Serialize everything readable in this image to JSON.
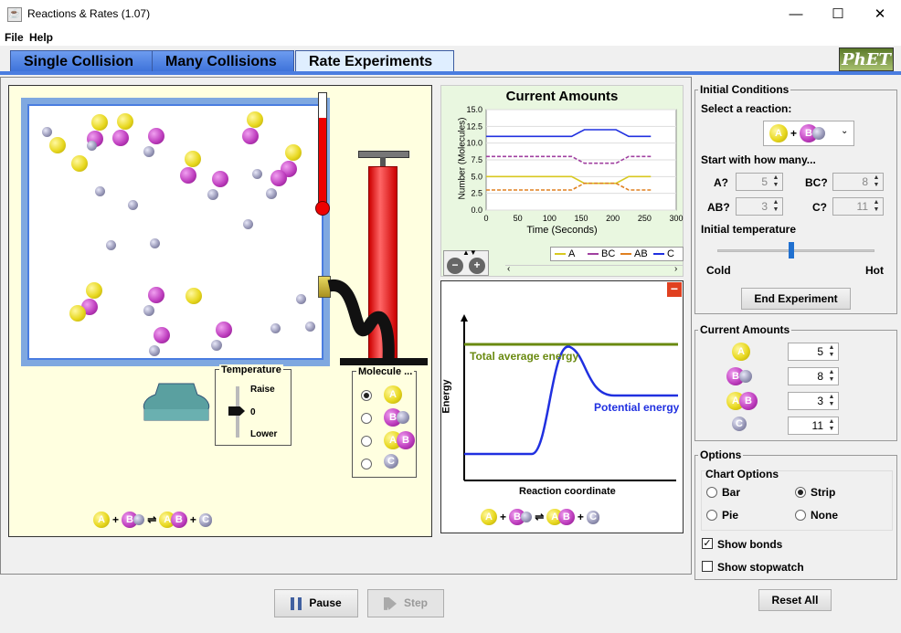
{
  "window": {
    "title": "Reactions & Rates (1.07)"
  },
  "menu": [
    "File",
    "Help"
  ],
  "tabs": [
    "Single Collision",
    "Many Collisions",
    "Rate Experiments"
  ],
  "logo": "PhET",
  "thermo_level": 0.78,
  "temperature_control": {
    "title": "Temperature",
    "raise": "Raise",
    "value": "0",
    "lower": "Lower"
  },
  "molecule_control": {
    "title": "Molecule ...",
    "options": [
      "A",
      "BC",
      "AB",
      "C"
    ],
    "selected": 0
  },
  "equation": {
    "a": "A",
    "plus": "+",
    "b": "B",
    "c": "C"
  },
  "chart": {
    "title": "Current Amounts",
    "ylabel": "Number (Molecules)",
    "xlabel": "Time (Seconds)",
    "legend": [
      "A",
      "BC",
      "AB",
      "C"
    ]
  },
  "chart_data": {
    "type": "line",
    "title": "Current Amounts",
    "xlabel": "Time (Seconds)",
    "ylabel": "Number (Molecules)",
    "xlim": [
      0,
      300
    ],
    "ylim": [
      0,
      15
    ],
    "xticks": [
      0,
      50,
      100,
      150,
      200,
      250,
      300
    ],
    "yticks": [
      "0.0",
      "2.5",
      "5.0",
      "7.5",
      "10.0",
      "12.5",
      "15.0"
    ],
    "x": [
      0,
      135,
      155,
      205,
      225,
      260
    ],
    "series": [
      {
        "name": "A",
        "color": "#d8c820",
        "values": [
          5,
          5,
          4,
          4,
          5,
          5
        ]
      },
      {
        "name": "BC",
        "color": "#a040a0",
        "values": [
          8,
          8,
          7,
          7,
          8,
          8
        ]
      },
      {
        "name": "AB",
        "color": "#e08020",
        "values": [
          3,
          3,
          4,
          4,
          3,
          3
        ]
      },
      {
        "name": "C",
        "color": "#2030e0",
        "values": [
          11,
          11,
          12,
          12,
          11,
          11
        ]
      }
    ]
  },
  "energy": {
    "total_label": "Total average energy",
    "potential_label": "Potential energy",
    "ylabel": "Energy",
    "xlabel": "Reaction coordinate",
    "colors": {
      "total": "#6a8a10",
      "potential": "#2030e0"
    }
  },
  "initial_conditions": {
    "title": "Initial Conditions",
    "select_label": "Select a reaction:",
    "start_label": "Start with how many...",
    "fields": [
      {
        "label": "A?",
        "value": "5"
      },
      {
        "label": "BC?",
        "value": "8"
      },
      {
        "label": "AB?",
        "value": "3"
      },
      {
        "label": "C?",
        "value": "11"
      }
    ],
    "initial_temp_label": "Initial temperature",
    "cold": "Cold",
    "hot": "Hot",
    "temp_level": 0.47,
    "end_button": "End Experiment"
  },
  "current_amounts": {
    "title": "Current Amounts",
    "values": [
      "5",
      "8",
      "3",
      "11"
    ]
  },
  "options": {
    "title": "Options",
    "chart_options_title": "Chart Options",
    "radios": [
      {
        "label": "Bar",
        "checked": false
      },
      {
        "label": "Strip",
        "checked": true
      },
      {
        "label": "Pie",
        "checked": false
      },
      {
        "label": "None",
        "checked": false
      }
    ],
    "show_bonds": "Show bonds",
    "show_stopwatch": "Show stopwatch"
  },
  "controls": {
    "pause": "Pause",
    "step": "Step",
    "reset": "Reset All"
  },
  "molecule_labels": {
    "A": "A",
    "B": "B",
    "C": "C"
  }
}
